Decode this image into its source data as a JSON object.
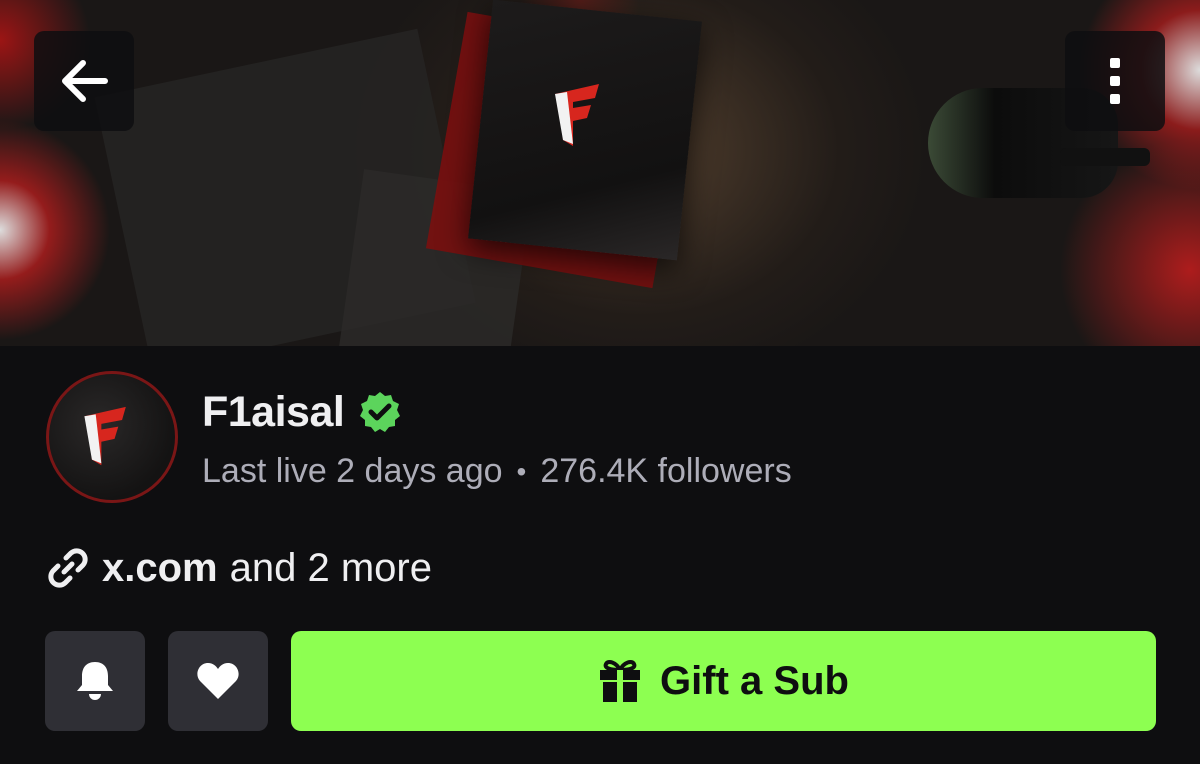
{
  "header": {
    "back_icon": "arrow-left-icon",
    "more_icon": "more-vertical-icon"
  },
  "profile": {
    "channel_name": "F1aisal",
    "verified_icon": "verified-badge-icon",
    "last_live": "Last live 2 days ago",
    "separator": "•",
    "followers": "276.4K followers"
  },
  "links": {
    "icon": "link-icon",
    "primary": "x.com",
    "more": "and 2 more"
  },
  "actions": {
    "bell_icon": "bell-icon",
    "heart_icon": "heart-icon",
    "gift_label": "Gift a Sub",
    "gift_icon": "gift-icon"
  },
  "colors": {
    "background": "#0e0e10",
    "accent_green": "#8dff51",
    "verified_green": "#5cd45c",
    "brand_red": "#d7261e",
    "secondary_text": "#adadb8"
  }
}
